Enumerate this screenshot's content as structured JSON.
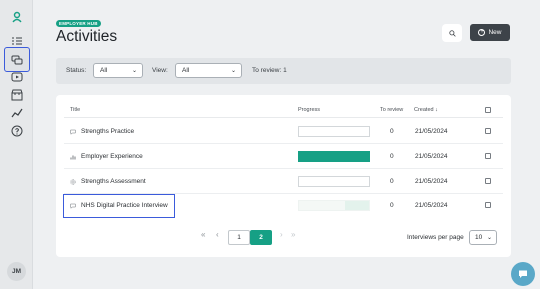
{
  "header": {
    "badge": "EMPLOYER HUB",
    "title": "Activities",
    "new_label": "New"
  },
  "sidebar": {
    "items": [
      {
        "icon": "logo-person-icon"
      },
      {
        "icon": "checklist-icon"
      },
      {
        "icon": "chat-bubbles-icon",
        "active": true
      },
      {
        "icon": "video-play-icon"
      },
      {
        "icon": "store-icon"
      },
      {
        "icon": "trend-chart-icon"
      },
      {
        "icon": "help-icon"
      }
    ],
    "avatar_initials": "JM"
  },
  "filters": {
    "status_label": "Status:",
    "status_value": "All",
    "view_label": "View:",
    "view_value": "All",
    "to_review": "To review: 1"
  },
  "table": {
    "columns": {
      "title": "Title",
      "progress": "Progress",
      "to_review": "To review",
      "created": "Created ↓"
    },
    "rows": [
      {
        "title": "Strengths Practice",
        "icon": "chat-icon",
        "progress": 0,
        "to_review": "0",
        "created": "21/05/2024"
      },
      {
        "title": "Employer Experience",
        "icon": "bar-chart-icon",
        "progress": 1.0,
        "to_review": "0",
        "created": "21/05/2024"
      },
      {
        "title": "Strengths Assessment",
        "icon": "gear-icon",
        "progress": 0,
        "to_review": "0",
        "created": "21/05/2024"
      },
      {
        "title": "NHS Digital Practice Interview",
        "icon": "chat-icon",
        "progress": 0.35,
        "to_review": "0",
        "created": "21/05/2024"
      }
    ]
  },
  "pagination": {
    "first": "«",
    "prev": "‹",
    "pages": [
      "1",
      "2"
    ],
    "current": "2",
    "next": "›",
    "last": "»",
    "per_page_label": "Interviews per page",
    "per_page_value": "10"
  },
  "colors": {
    "accent": "#16a085",
    "dark_button": "#3d4349",
    "highlight": "#3b5bdb"
  }
}
